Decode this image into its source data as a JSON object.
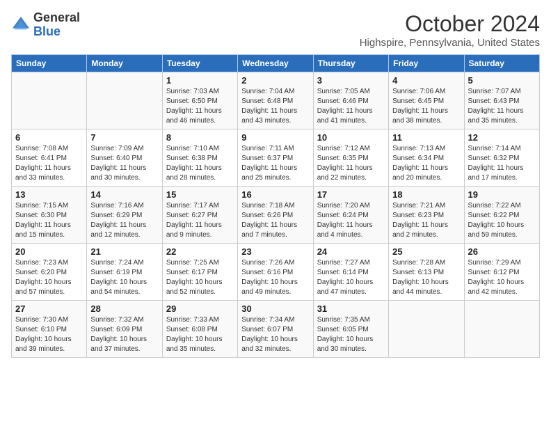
{
  "header": {
    "logo_general": "General",
    "logo_blue": "Blue",
    "month": "October 2024",
    "location": "Highspire, Pennsylvania, United States"
  },
  "days_of_week": [
    "Sunday",
    "Monday",
    "Tuesday",
    "Wednesday",
    "Thursday",
    "Friday",
    "Saturday"
  ],
  "weeks": [
    [
      {
        "day": "",
        "info": ""
      },
      {
        "day": "",
        "info": ""
      },
      {
        "day": "1",
        "info": "Sunrise: 7:03 AM\nSunset: 6:50 PM\nDaylight: 11 hours and 46 minutes."
      },
      {
        "day": "2",
        "info": "Sunrise: 7:04 AM\nSunset: 6:48 PM\nDaylight: 11 hours and 43 minutes."
      },
      {
        "day": "3",
        "info": "Sunrise: 7:05 AM\nSunset: 6:46 PM\nDaylight: 11 hours and 41 minutes."
      },
      {
        "day": "4",
        "info": "Sunrise: 7:06 AM\nSunset: 6:45 PM\nDaylight: 11 hours and 38 minutes."
      },
      {
        "day": "5",
        "info": "Sunrise: 7:07 AM\nSunset: 6:43 PM\nDaylight: 11 hours and 35 minutes."
      }
    ],
    [
      {
        "day": "6",
        "info": "Sunrise: 7:08 AM\nSunset: 6:41 PM\nDaylight: 11 hours and 33 minutes."
      },
      {
        "day": "7",
        "info": "Sunrise: 7:09 AM\nSunset: 6:40 PM\nDaylight: 11 hours and 30 minutes."
      },
      {
        "day": "8",
        "info": "Sunrise: 7:10 AM\nSunset: 6:38 PM\nDaylight: 11 hours and 28 minutes."
      },
      {
        "day": "9",
        "info": "Sunrise: 7:11 AM\nSunset: 6:37 PM\nDaylight: 11 hours and 25 minutes."
      },
      {
        "day": "10",
        "info": "Sunrise: 7:12 AM\nSunset: 6:35 PM\nDaylight: 11 hours and 22 minutes."
      },
      {
        "day": "11",
        "info": "Sunrise: 7:13 AM\nSunset: 6:34 PM\nDaylight: 11 hours and 20 minutes."
      },
      {
        "day": "12",
        "info": "Sunrise: 7:14 AM\nSunset: 6:32 PM\nDaylight: 11 hours and 17 minutes."
      }
    ],
    [
      {
        "day": "13",
        "info": "Sunrise: 7:15 AM\nSunset: 6:30 PM\nDaylight: 11 hours and 15 minutes."
      },
      {
        "day": "14",
        "info": "Sunrise: 7:16 AM\nSunset: 6:29 PM\nDaylight: 11 hours and 12 minutes."
      },
      {
        "day": "15",
        "info": "Sunrise: 7:17 AM\nSunset: 6:27 PM\nDaylight: 11 hours and 9 minutes."
      },
      {
        "day": "16",
        "info": "Sunrise: 7:18 AM\nSunset: 6:26 PM\nDaylight: 11 hours and 7 minutes."
      },
      {
        "day": "17",
        "info": "Sunrise: 7:20 AM\nSunset: 6:24 PM\nDaylight: 11 hours and 4 minutes."
      },
      {
        "day": "18",
        "info": "Sunrise: 7:21 AM\nSunset: 6:23 PM\nDaylight: 11 hours and 2 minutes."
      },
      {
        "day": "19",
        "info": "Sunrise: 7:22 AM\nSunset: 6:22 PM\nDaylight: 10 hours and 59 minutes."
      }
    ],
    [
      {
        "day": "20",
        "info": "Sunrise: 7:23 AM\nSunset: 6:20 PM\nDaylight: 10 hours and 57 minutes."
      },
      {
        "day": "21",
        "info": "Sunrise: 7:24 AM\nSunset: 6:19 PM\nDaylight: 10 hours and 54 minutes."
      },
      {
        "day": "22",
        "info": "Sunrise: 7:25 AM\nSunset: 6:17 PM\nDaylight: 10 hours and 52 minutes."
      },
      {
        "day": "23",
        "info": "Sunrise: 7:26 AM\nSunset: 6:16 PM\nDaylight: 10 hours and 49 minutes."
      },
      {
        "day": "24",
        "info": "Sunrise: 7:27 AM\nSunset: 6:14 PM\nDaylight: 10 hours and 47 minutes."
      },
      {
        "day": "25",
        "info": "Sunrise: 7:28 AM\nSunset: 6:13 PM\nDaylight: 10 hours and 44 minutes."
      },
      {
        "day": "26",
        "info": "Sunrise: 7:29 AM\nSunset: 6:12 PM\nDaylight: 10 hours and 42 minutes."
      }
    ],
    [
      {
        "day": "27",
        "info": "Sunrise: 7:30 AM\nSunset: 6:10 PM\nDaylight: 10 hours and 39 minutes."
      },
      {
        "day": "28",
        "info": "Sunrise: 7:32 AM\nSunset: 6:09 PM\nDaylight: 10 hours and 37 minutes."
      },
      {
        "day": "29",
        "info": "Sunrise: 7:33 AM\nSunset: 6:08 PM\nDaylight: 10 hours and 35 minutes."
      },
      {
        "day": "30",
        "info": "Sunrise: 7:34 AM\nSunset: 6:07 PM\nDaylight: 10 hours and 32 minutes."
      },
      {
        "day": "31",
        "info": "Sunrise: 7:35 AM\nSunset: 6:05 PM\nDaylight: 10 hours and 30 minutes."
      },
      {
        "day": "",
        "info": ""
      },
      {
        "day": "",
        "info": ""
      }
    ]
  ]
}
